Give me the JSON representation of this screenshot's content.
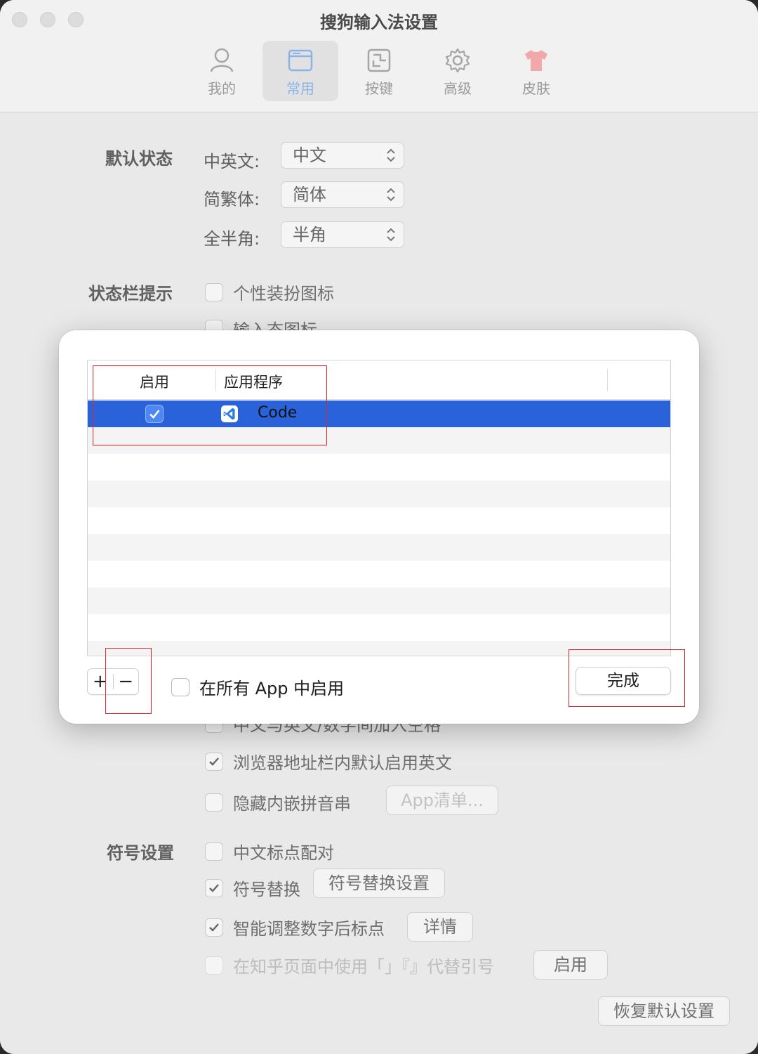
{
  "window": {
    "title": "搜狗输入法设置"
  },
  "tabs": [
    {
      "label": "我的",
      "icon": "person-icon",
      "active": false
    },
    {
      "label": "常用",
      "icon": "window-icon",
      "active": true
    },
    {
      "label": "按键",
      "icon": "keys-icon",
      "active": false
    },
    {
      "label": "高级",
      "icon": "gear-icon",
      "active": false
    },
    {
      "label": "皮肤",
      "icon": "shirt-icon",
      "active": false
    }
  ],
  "default_state": {
    "section": "默认状态",
    "rows": [
      {
        "label": "中英文:",
        "value": "中文"
      },
      {
        "label": "简繁体:",
        "value": "简体"
      },
      {
        "label": "全半角:",
        "value": "半角"
      }
    ]
  },
  "statusbar": {
    "section": "状态栏提示",
    "items": [
      {
        "label": "个性装扮图标",
        "checked": false
      },
      {
        "label": "输入态图标",
        "checked": false
      }
    ]
  },
  "misc": {
    "partial_label": "中文与英文/数字间加入空格",
    "browser_english": {
      "label": "浏览器地址栏内默认启用英文",
      "checked": true
    },
    "hide_pinyin": {
      "label": "隐藏内嵌拼音串",
      "checked": false,
      "button": "App清单..."
    }
  },
  "symbols": {
    "section": "符号设置",
    "pair": {
      "label": "中文标点配对",
      "checked": false
    },
    "replace": {
      "label": "符号替换",
      "checked": true,
      "button": "符号替换设置"
    },
    "smart": {
      "label": "智能调整数字后标点",
      "checked": true,
      "button": "详情"
    },
    "zhihu": {
      "label": "在知乎页面中使用「」『』代替引号",
      "checked": false,
      "button": "启用"
    }
  },
  "restore_button": "恢复默认设置",
  "dialog": {
    "columns": [
      "启用",
      "应用程序"
    ],
    "rows": [
      {
        "enabled": true,
        "app": "Code"
      }
    ],
    "add_label": "+",
    "remove_label": "−",
    "all_apps_label": "在所有 App 中启用",
    "all_apps_checked": false,
    "done_label": "完成"
  },
  "colors": {
    "selection": "#2962d9",
    "accent_tab": "#8ab4e6",
    "annotation": "#e0262a"
  }
}
